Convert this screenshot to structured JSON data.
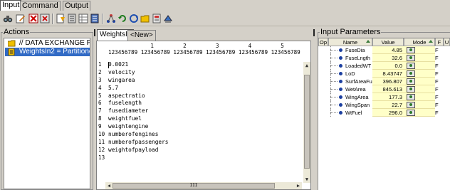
{
  "tabs": [
    "Input",
    "Command",
    "Output"
  ],
  "toolbar": {
    "icons": [
      "binoculars-icon",
      "edit-icon",
      "delete-red-icon",
      "delete-icon",
      "new-doc-icon",
      "list-icon",
      "table-icon",
      "grid-icon",
      "tree-icon",
      "refresh-icon",
      "sync-icon",
      "folder-icon",
      "calc-icon",
      "settings-icon"
    ]
  },
  "actions": {
    "title": "Actions",
    "items": [
      {
        "label": "// DATA EXCHANGE PROG",
        "icon": "folder-icon",
        "selected": false
      },
      {
        "label": "WeightsIn2 = Partitioner / T",
        "icon": "doc-icon",
        "selected": true
      }
    ]
  },
  "editor": {
    "tabs": [
      "WeightsIn",
      "<New>"
    ],
    "ruler_top": "             1         2         3         4         5         ",
    "ruler_bottom": "123456789 123456789 123456789 123456789 123456789 123456789",
    "lines": [
      "0.0021",
      "velocity",
      "wingarea",
      "5.7",
      "aspectratio",
      "fuselength",
      "fusediameter",
      "weightfuel",
      "weightengine",
      "numberofengines",
      "numberofpassengers",
      "weightofpayload",
      ""
    ],
    "line_numbers": [
      "1",
      "2",
      "3",
      "4",
      "5",
      "6",
      "7",
      "8",
      "9",
      "10",
      "11",
      "12",
      "13"
    ],
    "hscroll_label": "III"
  },
  "params": {
    "title": "Input Parameters",
    "columns": {
      "op": "Op",
      "name": "Name",
      "value": "Value",
      "mode": "Mode",
      "x": "F",
      "y": "U"
    },
    "rows": [
      {
        "name": "FuseDia",
        "value": "4.85",
        "flag": "F"
      },
      {
        "name": "FuseLngth",
        "value": "32.6",
        "flag": "F"
      },
      {
        "name": "LoadedWT",
        "value": "0.0",
        "flag": "F"
      },
      {
        "name": "LoD",
        "value": "8.43747",
        "flag": "F"
      },
      {
        "name": "SurfAreaFus",
        "value": "396.807",
        "flag": "F"
      },
      {
        "name": "WetArea",
        "value": "845.613",
        "flag": "F"
      },
      {
        "name": "WingArea",
        "value": "177.3",
        "flag": "F"
      },
      {
        "name": "WingSpan",
        "value": "22.7",
        "flag": "F"
      },
      {
        "name": "WtFuel",
        "value": "296.0",
        "flag": "F"
      }
    ]
  },
  "colors": {
    "selection": "#316ac5",
    "value_bg": "#ffffc8",
    "panel": "#d4d0c8"
  }
}
